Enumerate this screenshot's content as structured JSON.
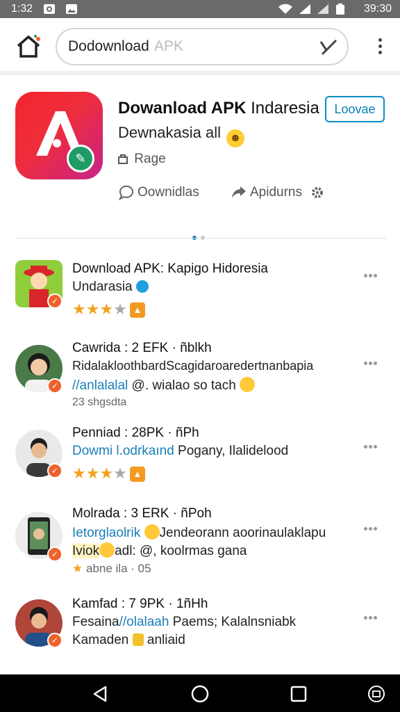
{
  "status": {
    "time": "1:32",
    "clock": "39:30"
  },
  "browser": {
    "search_value": "Dodownload",
    "search_placeholder": "APK"
  },
  "hero": {
    "title_bold": "Dowanload APK",
    "title_rest": " Indaresia",
    "subtitle": "Dewnakasia all",
    "rating": "Rage",
    "button": "Loovae",
    "action1": "Oownidlas",
    "action2": "Apidurns"
  },
  "items": [
    {
      "l1": "Download APK: Kapigo Hidoresia",
      "l2": "Undarasia"
    },
    {
      "l1": "Cawrida : 2 EFK · ñblkh",
      "l2": "RidalakloothbardScagidaroaredertnanbapia",
      "l3a": "//anlalalal",
      "l3b": " @. wialao so tach",
      "l4": "23 shgsdta"
    },
    {
      "l1": "Penniad : 28PK · ñPh",
      "l2a": "Dowmi l.odrkaınd",
      "l2b": " Pogany, Ilalidelood"
    },
    {
      "l1": "Molrada : 3 ERK · ñPoh",
      "l2a": "Ietorglaolrik",
      "l2b": "Jendeorann aoorinaulaklapu",
      "l3a": "Iviok",
      "l3b": "adl: @, koolrmas gana",
      "l4": "abne ila · 05"
    },
    {
      "l1": "Kamfad : 7 9PK · 1ñHh",
      "l2a": "Fesaina",
      "l2b": "//olalaah",
      "l2c": " Paems; Kalalnsniabk",
      "l3a": "Kamaden",
      "l3b": "anliaid"
    }
  ],
  "colors": {
    "accent": "#0a8fc6",
    "star": "#f2a11f",
    "badge": "#f0612a"
  }
}
